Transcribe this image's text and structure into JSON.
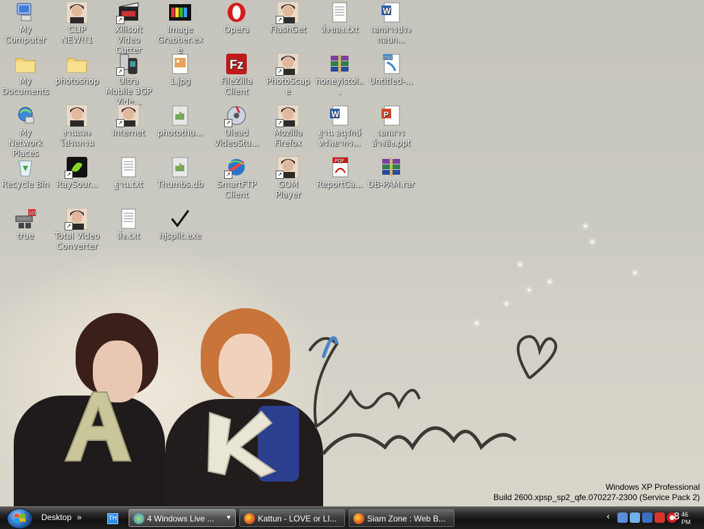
{
  "desktop": {
    "icons": [
      {
        "label": "My Computer",
        "icon": "computer-icon",
        "shortcut": false
      },
      {
        "label": "My Documents",
        "icon": "documents-folder-icon",
        "shortcut": false
      },
      {
        "label": "My Network Places",
        "icon": "network-places-icon",
        "shortcut": false
      },
      {
        "label": "Recycle Bin",
        "icon": "recycle-bin-icon",
        "shortcut": false
      },
      {
        "label": "true",
        "icon": "network-server-icon",
        "shortcut": false
      },
      {
        "label": "CLIP NEW!!1",
        "icon": "photo-thumbnail-icon",
        "shortcut": false
      },
      {
        "label": "photoshop",
        "icon": "folder-icon",
        "shortcut": false
      },
      {
        "label": "งานและโปรแกรม",
        "icon": "photo-thumbnail-icon",
        "shortcut": false
      },
      {
        "label": "RaySour...",
        "icon": "raysource-icon",
        "shortcut": true
      },
      {
        "label": "Total Video Converter",
        "icon": "photo-thumbnail-icon",
        "shortcut": true
      },
      {
        "label": "Xilisoft Video Cutter",
        "icon": "video-cutter-icon",
        "shortcut": true
      },
      {
        "label": "Ultra Mobile 3GP Vide...",
        "icon": "mobile-video-icon",
        "shortcut": true
      },
      {
        "label": "Internet",
        "icon": "photo-thumbnail-icon",
        "shortcut": true
      },
      {
        "label": "ฐาน.txt",
        "icon": "text-file-icon",
        "shortcut": false
      },
      {
        "label": "สิ่ง.txt",
        "icon": "text-file-icon",
        "shortcut": false
      },
      {
        "label": "Image Grabber.exe",
        "icon": "image-grabber-icon",
        "shortcut": false
      },
      {
        "label": "1.jpg",
        "icon": "jpg-file-icon",
        "shortcut": false
      },
      {
        "label": "photothu...",
        "icon": "puzzle-file-icon",
        "shortcut": false
      },
      {
        "label": "Thumbs.db",
        "icon": "puzzle-file-icon",
        "shortcut": false
      },
      {
        "label": "hjsplit.exe",
        "icon": "checkmark-icon",
        "shortcut": false
      },
      {
        "label": "Opera",
        "icon": "opera-icon",
        "shortcut": false
      },
      {
        "label": "FileZilla Client",
        "icon": "filezilla-icon",
        "shortcut": false
      },
      {
        "label": "Ulead VideoStu...",
        "icon": "ulead-icon",
        "shortcut": true
      },
      {
        "label": "SmartFTP Client",
        "icon": "smartftp-icon",
        "shortcut": true
      },
      {
        "label": "FlashGet",
        "icon": "photo-thumbnail-icon",
        "shortcut": true
      },
      {
        "label": "PhotoScape",
        "icon": "photo-thumbnail-icon",
        "shortcut": true
      },
      {
        "label": "Mozilla Firefox",
        "icon": "photo-thumbnail-icon",
        "shortcut": true
      },
      {
        "label": "GOM Player",
        "icon": "photo-thumbnail-icon",
        "shortcut": true
      },
      {
        "label": "สิ่งของ.txt",
        "icon": "text-file-icon",
        "shortcut": false
      },
      {
        "label": "honeyistol...",
        "icon": "rar-archive-icon",
        "shortcut": false
      },
      {
        "label": "ฐาน อนุรักษ์ทรัพยากร...",
        "icon": "word-doc-icon",
        "shortcut": false
      },
      {
        "label": "ReportCa...",
        "icon": "pdf-file-icon",
        "shortcut": false
      },
      {
        "label": "เอกสารประกอบก...",
        "icon": "word-doc-icon",
        "shortcut": false
      },
      {
        "label": "Untitled-...",
        "icon": "psd-file-icon",
        "shortcut": false
      },
      {
        "label": "เอกสารอ้างอิง.ppt",
        "icon": "powerpoint-file-icon",
        "shortcut": false
      },
      {
        "label": "DB-PAM.rar",
        "icon": "rar-archive-icon",
        "shortcut": false
      }
    ]
  },
  "sysinfo": {
    "line1": "Windows XP Professional",
    "line2": "Build 2600.xpsp_sp2_qfe.070227-2300 (Service Pack 2)"
  },
  "taskbar": {
    "desktop_toolbar": "Desktop",
    "desktop_chevron": "»",
    "quicklaunch_label": "TH",
    "tasks": [
      {
        "label": "4 Windows Live ...",
        "icon": "windows-live-icon",
        "grouped": true
      },
      {
        "label": "Kattun - LOVE or LI...",
        "icon": "firefox-icon",
        "grouped": false
      },
      {
        "label": "Siam Zone : Web B...",
        "icon": "firefox-icon",
        "grouped": false
      }
    ],
    "tray_expand": "‹",
    "tray_icons": [
      "network-icon",
      "user-icon",
      "volume-icon",
      "antivirus-icon",
      "opera-tray-icon"
    ],
    "clock": {
      "hour": "8",
      "minute": "46",
      "ampm": "PM"
    }
  },
  "colors": {
    "taskbar": "#1e1e1e",
    "desktop": "#c9c8c0",
    "icon_text": "#ffffff"
  }
}
